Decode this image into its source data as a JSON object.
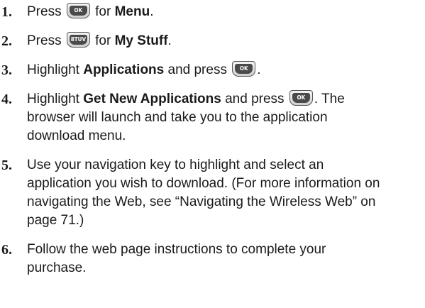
{
  "steps": [
    {
      "number": "1.",
      "pre": "Press ",
      "key": "menu-ok-key",
      "mid": " for ",
      "bold": "Menu",
      "post": "."
    },
    {
      "number": "2.",
      "pre": "Press ",
      "key": "8-key",
      "mid": " for ",
      "bold": "My Stuff",
      "post": "."
    },
    {
      "number": "3.",
      "pre": "Highlight ",
      "bold": "Applications",
      "mid": " and press ",
      "key": "menu-ok-key",
      "post": "."
    },
    {
      "number": "4.",
      "pre": "Highlight ",
      "bold": "Get New Applications",
      "mid": " and press ",
      "key": "menu-ok-key",
      "post": ". The",
      "line2": "browser will launch and take you to the application",
      "line3": "download menu."
    },
    {
      "number": "5.",
      "line1": "Use your navigation key to highlight and select an",
      "line2": "application you wish to download. (For more information on",
      "line3": "navigating the Web, see “Navigating the Wireless Web” on",
      "line4": "page 71.)"
    },
    {
      "number": "6.",
      "line1": "Follow the web page instructions to complete your",
      "line2": "purchase."
    }
  ],
  "keys": {
    "menu_ok_cap": "OK",
    "eight_cap": "8TUV"
  }
}
